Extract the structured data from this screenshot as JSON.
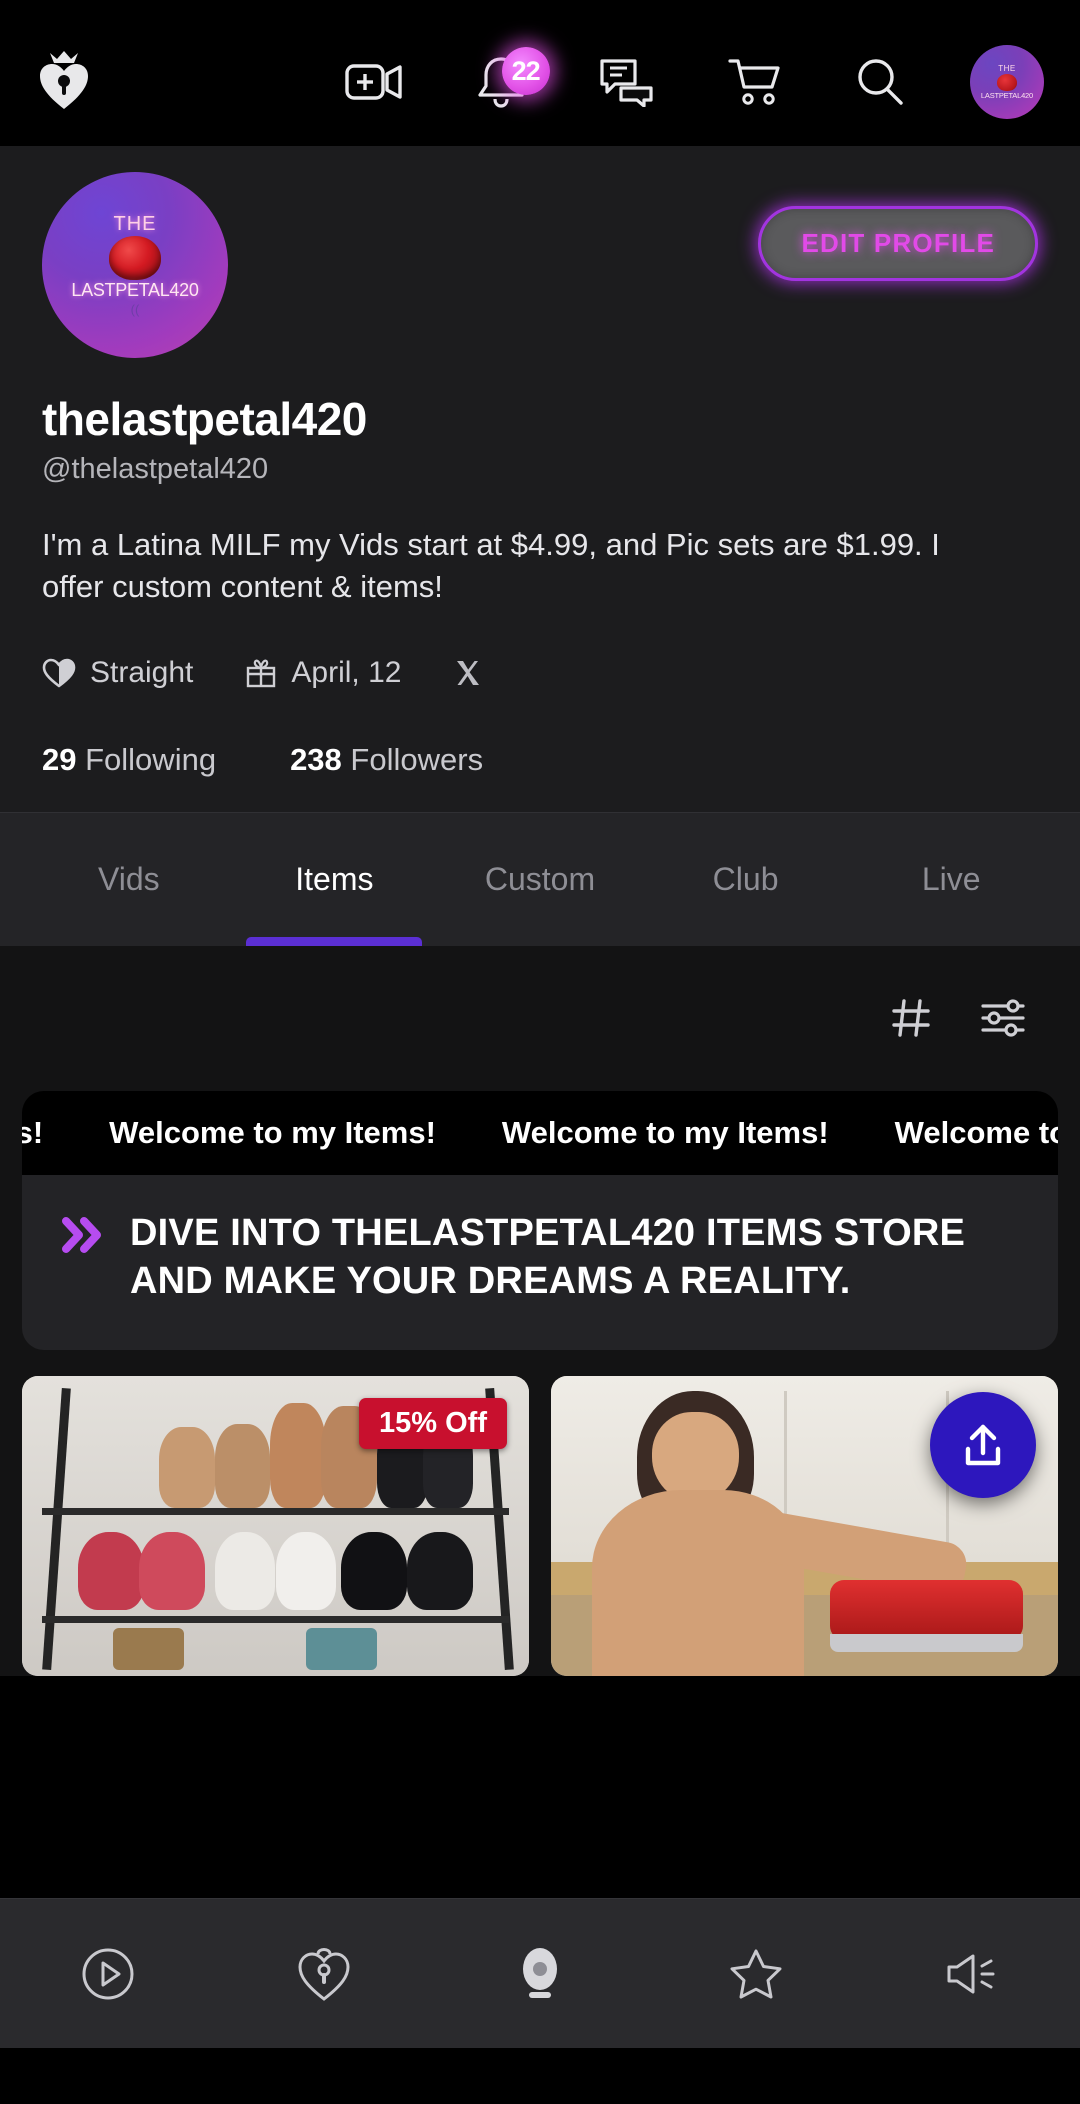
{
  "appbar": {
    "logo_icon": "heart-crown-lock-logo",
    "icons": [
      {
        "name": "video-add-icon",
        "label": "Go live"
      },
      {
        "name": "bell-icon",
        "label": "Notifications",
        "badge": "22"
      },
      {
        "name": "chat-icon",
        "label": "Messages"
      },
      {
        "name": "cart-icon",
        "label": "Cart"
      },
      {
        "name": "search-icon",
        "label": "Search"
      }
    ],
    "avatar": {
      "line1": "THE",
      "line2": "LASTPETAL420"
    }
  },
  "profile": {
    "avatar": {
      "line1": "THE",
      "line2": "LASTPETAL420",
      "line3": "(("
    },
    "edit_button": "EDIT PROFILE",
    "display_name": "thelastpetal420",
    "handle": "@thelastpetal420",
    "bio": "I'm a Latina MILF my Vids start at $4.99, and Pic sets are $1.99. I offer custom content & items!",
    "meta": [
      {
        "icon": "heart-half-icon",
        "label": "Straight"
      },
      {
        "icon": "gift-icon",
        "label": "April, 12"
      },
      {
        "icon": "x-twitter-icon",
        "label": ""
      }
    ],
    "stats": [
      {
        "count": "29",
        "label": "Following"
      },
      {
        "count": "238",
        "label": "Followers"
      }
    ]
  },
  "tabs": [
    {
      "label": "Vids",
      "active": false
    },
    {
      "label": "Items",
      "active": true
    },
    {
      "label": "Custom",
      "active": false
    },
    {
      "label": "Club",
      "active": false
    },
    {
      "label": "Live",
      "active": false
    }
  ],
  "filters": [
    {
      "name": "hashtag-icon"
    },
    {
      "name": "sliders-filter-icon"
    }
  ],
  "marquee": {
    "text": "Welcome to my Items!",
    "items": [
      "y Items!",
      "Welcome to my Items!",
      "Welcome to my Items!",
      "Welcome to"
    ]
  },
  "headline": {
    "chevron_icon": "double-chevron-right-icon",
    "text": "DIVE INTO THELASTPETAL420 ITEMS STORE AND MAKE YOUR DREAMS A REALITY."
  },
  "products": [
    {
      "name": "shoe-rack-item",
      "badge": "15% Off",
      "image_alt": "Shoe rack with sandals, sneakers and heels"
    },
    {
      "name": "kitchen-item",
      "badge": "",
      "fab_icon": "upload-icon",
      "image_alt": "Creator in kitchen with red appliance"
    }
  ],
  "bottom_nav": [
    {
      "name": "play-circle-icon",
      "active": false
    },
    {
      "name": "heart-lock-icon",
      "active": false
    },
    {
      "name": "webcam-icon",
      "active": true
    },
    {
      "name": "star-icon",
      "active": false
    },
    {
      "name": "megaphone-icon",
      "active": false
    }
  ],
  "colors": {
    "accent_purple": "#5b2fd4",
    "accent_magenta": "#e24ae8",
    "badge_red": "#c8102e",
    "fab_indigo": "#2d17bd",
    "surface": "#1c1c1e",
    "surface_dark": "#131314"
  }
}
